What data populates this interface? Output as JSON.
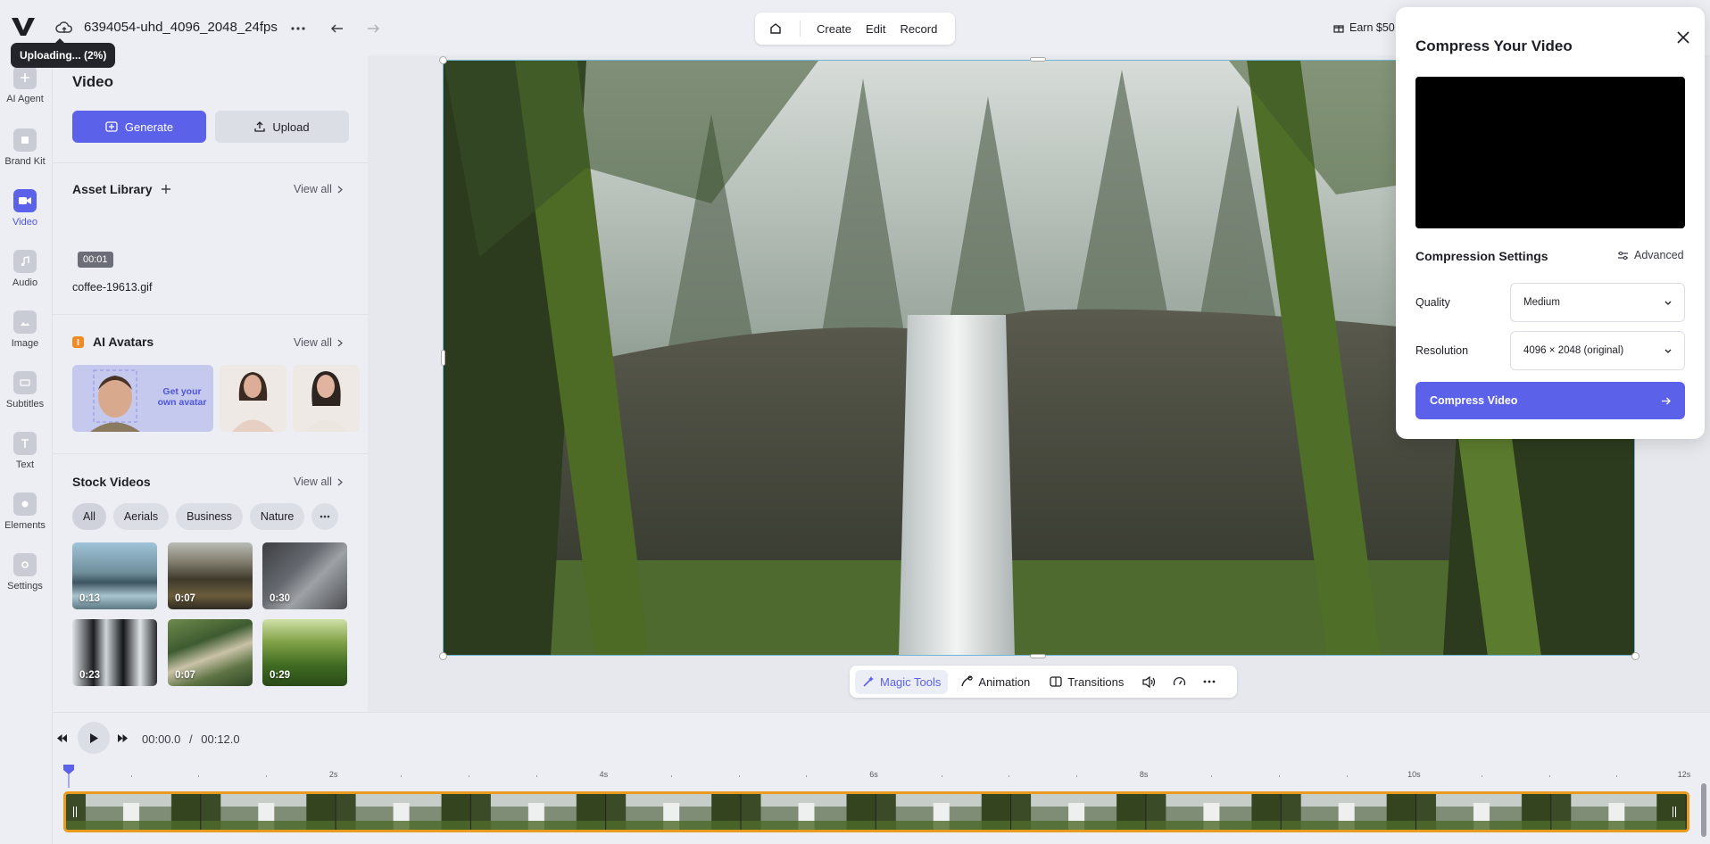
{
  "header": {
    "filename": "6394054-uhd_4096_2048_24fps",
    "upload_status": "Uploading... (2%)",
    "nav": [
      "Create",
      "Edit",
      "Record"
    ],
    "earn_label": "Earn $50"
  },
  "rail": [
    {
      "label": "AI Agent",
      "icon": "ai-agent-icon"
    },
    {
      "label": "Brand Kit",
      "icon": "brand-kit-icon"
    },
    {
      "label": "Video",
      "icon": "video-icon",
      "active": true
    },
    {
      "label": "Audio",
      "icon": "music-note-icon"
    },
    {
      "label": "Image",
      "icon": "image-icon"
    },
    {
      "label": "Subtitles",
      "icon": "subtitles-icon"
    },
    {
      "label": "Text",
      "icon": "text-icon"
    },
    {
      "label": "Elements",
      "icon": "elements-icon"
    },
    {
      "label": "Settings",
      "icon": "settings-icon"
    }
  ],
  "panel": {
    "title": "Video",
    "generate_label": "Generate",
    "upload_label": "Upload",
    "asset_library": {
      "title": "Asset Library",
      "view_all": "View all",
      "items": [
        {
          "duration": "00:01",
          "name": "coffee-19613.gif"
        }
      ]
    },
    "ai_avatars": {
      "title": "AI Avatars",
      "view_all": "View all",
      "promo": "Get your own avatar"
    },
    "stock_videos": {
      "title": "Stock Videos",
      "view_all": "View all",
      "filters": [
        "All",
        "Aerials",
        "Business",
        "Nature"
      ],
      "active_filter": "All",
      "thumbs": [
        "0:13",
        "0:07",
        "0:30",
        "0:23",
        "0:07",
        "0:29"
      ]
    }
  },
  "video_toolbar": {
    "items": [
      "Magic Tools",
      "Animation",
      "Transitions"
    ],
    "active": "Magic Tools"
  },
  "compress": {
    "title": "Compress Your Video",
    "settings_title": "Compression Settings",
    "advanced": "Advanced",
    "quality_label": "Quality",
    "quality_value": "Medium",
    "resolution_label": "Resolution",
    "resolution_value": "4096 × 2048 (original)",
    "cta": "Compress Video"
  },
  "timeline": {
    "current": "00:00.0",
    "separator": "/",
    "total": "00:12.0",
    "ruler_labels": [
      "2s",
      "4s",
      "6s",
      "8s",
      "10s",
      "12s"
    ]
  },
  "colors": {
    "accent": "#5b61e8",
    "clip_border": "#e89b1c",
    "selection": "#6fb6d0"
  }
}
